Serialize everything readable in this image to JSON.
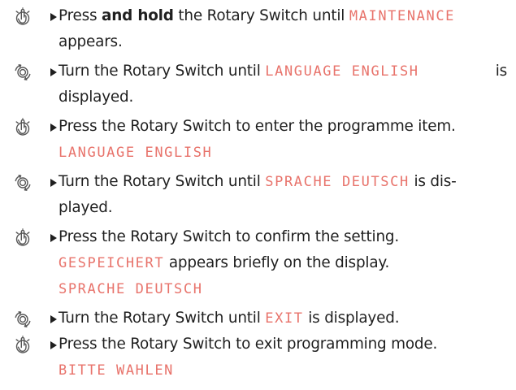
{
  "colors": {
    "text": "#1f1f1f",
    "display": "#e8736b",
    "icon": "#555555"
  },
  "icons": {
    "press": "finger-press-icon",
    "turn": "rotary-turn-icon"
  },
  "steps": [
    {
      "icon": "finger-press-icon",
      "l1a": "Press ",
      "l1b": "and hold",
      "l1c": " the Rotary Switch until ",
      "disp1": "MAINTENANCE",
      "l2": "appears."
    },
    {
      "icon": "rotary-turn-icon",
      "l1a": "Turn the Rotary Switch until ",
      "disp1": "LANGUAGE ENGLISH",
      "l1c": "is",
      "l2": "displayed."
    },
    {
      "icon": "finger-press-icon",
      "l1a": "Press the Rotary Switch to enter the programme item.",
      "disp2": "LANGUAGE ENGLISH"
    },
    {
      "icon": "rotary-turn-icon",
      "l1a": "Turn the Rotary Switch until ",
      "disp1": "SPRACHE DEUTSCH",
      "l1c": " is dis-",
      "l2": "played."
    },
    {
      "icon": "finger-press-icon",
      "l1a": "Press the Rotary Switch to confirm the setting.",
      "disp2": "GESPEICHERT",
      "l2": " appears briefly on the display.",
      "disp3": "SPRACHE DEUTSCH"
    },
    {
      "icon": "rotary-turn-icon",
      "l1a": "Turn the Rotary Switch until ",
      "disp1": "EXIT",
      "l1c": " is displayed."
    },
    {
      "icon": "finger-press-icon",
      "l1a": "Press the Rotary Switch to exit programming mode.",
      "disp2": "BITTE WAHLEN"
    }
  ]
}
